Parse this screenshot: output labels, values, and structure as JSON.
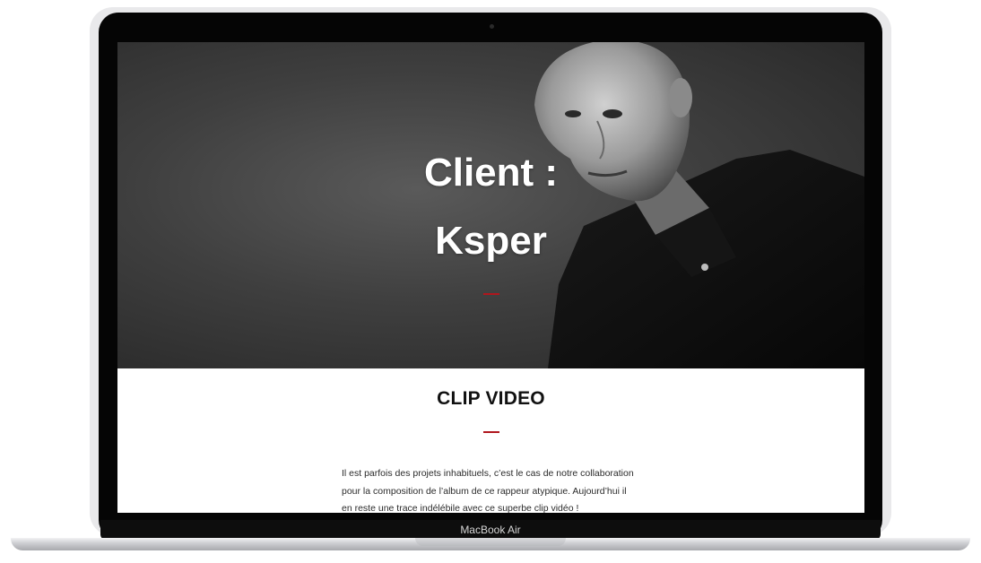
{
  "hero": {
    "title_line1": "Client :",
    "title_line2": "Ksper"
  },
  "section": {
    "title": "CLIP VIDEO",
    "body_lines": [
      "Il est parfois des projets inhabituels, c’est le cas de notre collaboration",
      "pour la composition de l’album de ce rappeur atypique. Aujourd’hui il",
      "en reste une trace indélébile avec ce superbe clip vidéo !"
    ]
  },
  "device": {
    "label": "MacBook Air"
  },
  "colors": {
    "accent": "#b0161d",
    "hero_bg": "#3f3f3f"
  }
}
